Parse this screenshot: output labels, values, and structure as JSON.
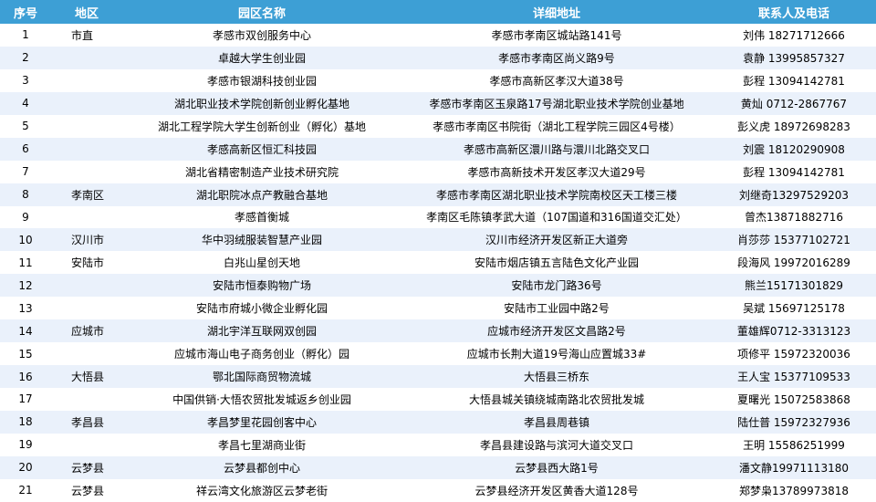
{
  "headers": {
    "index": "序号",
    "region": "地区",
    "park": "园区名称",
    "address": "详细地址",
    "contact": "联系人及电话"
  },
  "rows": [
    {
      "index": "1",
      "region": "市直",
      "park": "孝感市双创服务中心",
      "address": "孝感市孝南区城站路141号",
      "contact": "刘伟 18271712666"
    },
    {
      "index": "2",
      "region": "",
      "park": "卓越大学生创业园",
      "address": "孝感市孝南区尚义路9号",
      "contact": "袁静 13995857327"
    },
    {
      "index": "3",
      "region": "",
      "park": "孝感市银湖科技创业园",
      "address": "孝感市高新区孝汉大道38号",
      "contact": "彭程 13094142781"
    },
    {
      "index": "4",
      "region": "",
      "park": "湖北职业技术学院创新创业孵化基地",
      "address": "孝感市孝南区玉泉路17号湖北职业技术学院创业基地",
      "contact": "黄灿 0712-2867767"
    },
    {
      "index": "5",
      "region": "",
      "park": "湖北工程学院大学生创新创业（孵化）基地",
      "address": "孝感市孝南区书院街（湖北工程学院三园区4号楼）",
      "contact": "彭义虎 18972698283"
    },
    {
      "index": "6",
      "region": "",
      "park": "孝感高新区恒汇科技园",
      "address": "孝感市高新区澴川路与澴川北路交叉口",
      "contact": "刘震 18120290908"
    },
    {
      "index": "7",
      "region": "",
      "park": "湖北省精密制造产业技术研究院",
      "address": "孝感市高新技术开发区孝汉大道29号",
      "contact": "彭程 13094142781"
    },
    {
      "index": "8",
      "region": "孝南区",
      "park": "湖北职院冰点产教融合基地",
      "address": "孝感市孝南区湖北职业技术学院南校区天工楼三楼",
      "contact": "刘继奇13297529203"
    },
    {
      "index": "9",
      "region": "",
      "park": "孝感首衡城",
      "address": "孝南区毛陈镇孝武大道（107国道和316国道交汇处）",
      "contact": "曾杰13871882716"
    },
    {
      "index": "10",
      "region": "汉川市",
      "park": "华中羽绒服装智慧产业园",
      "address": "汉川市经济开发区新正大道旁",
      "contact": "肖莎莎 15377102721"
    },
    {
      "index": "11",
      "region": "安陆市",
      "park": "白兆山星创天地",
      "address": "安陆市烟店镇五言陆色文化产业园",
      "contact": "段海风 19972016289"
    },
    {
      "index": "12",
      "region": "",
      "park": "安陆市恒泰购物广场",
      "address": "安陆市龙门路36号",
      "contact": "熊兰15171301829"
    },
    {
      "index": "13",
      "region": "",
      "park": "安陆市府城小微企业孵化园",
      "address": "安陆市工业园中路2号",
      "contact": "吴斌 15697125178"
    },
    {
      "index": "14",
      "region": "应城市",
      "park": "湖北宇洋互联网双创园",
      "address": "应城市经济开发区文昌路2号",
      "contact": "董雄辉0712-3313123"
    },
    {
      "index": "15",
      "region": "",
      "park": "应城市海山电子商务创业（孵化）园",
      "address": "应城市长荆大道19号海山应置城33#",
      "contact": "项修平 15972320036"
    },
    {
      "index": "16",
      "region": "大悟县",
      "park": "鄂北国际商贸物流城",
      "address": "大悟县三桥东",
      "contact": "王人宝 15377109533"
    },
    {
      "index": "17",
      "region": "",
      "park": "中国供销·大悟农贸批发城返乡创业园",
      "address": "大悟县城关镇绕城南路北农贸批发城",
      "contact": "夏曙光 15072583868"
    },
    {
      "index": "18",
      "region": "孝昌县",
      "park": "孝昌梦里花园创客中心",
      "address": "孝昌县周巷镇",
      "contact": "陆仕普 15972327936"
    },
    {
      "index": "19",
      "region": "",
      "park": "孝昌七里湖商业街",
      "address": "孝昌县建设路与滨河大道交叉口",
      "contact": "王明 15586251999"
    },
    {
      "index": "20",
      "region": "云梦县",
      "park": "云梦县都创中心",
      "address": "云梦县西大路1号",
      "contact": "潘文静19971113180"
    },
    {
      "index": "21",
      "region": "云梦县",
      "park": "祥云湾文化旅游区云梦老街",
      "address": "云梦县经济开发区黄香大道128号",
      "contact": "郑梦枭13789973818"
    }
  ]
}
